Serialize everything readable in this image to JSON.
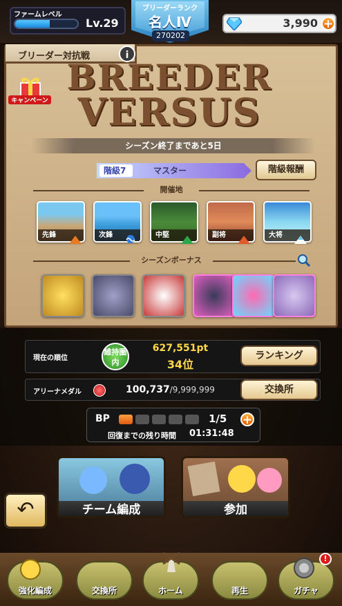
{
  "header": {
    "farm_level_label": "ファームレベル",
    "exp_progress": 0.55,
    "level": "Lv.29",
    "breeder_rank_label": "ブリーダーランク",
    "breeder_rank": "名人Ⅳ",
    "breeder_rank_id": "270202",
    "gems": "3,990",
    "gem_icon": "diamond-icon",
    "accent_color": "#e06000"
  },
  "panel": {
    "title": "ブリーダー対抗戦",
    "info_label": "i",
    "campaign_label": "キャンペーン",
    "logo_line1": "BREEDER",
    "logo_line2": "VERSUS",
    "season_text": "シーズン終了まであと5日",
    "tier_label": "階級7",
    "tier_name": "マスター",
    "tier_reward_button": "階級報酬",
    "venue_heading": "開催地",
    "venues": [
      {
        "label": "先鋒"
      },
      {
        "label": "次鋒"
      },
      {
        "label": "中堅"
      },
      {
        "label": "副将"
      },
      {
        "label": "大将"
      }
    ],
    "bonus_heading": "シーズンボーナス"
  },
  "ranking": {
    "current_label": "現在の順位",
    "status_badge": "維持圏内",
    "points": "627,551pt",
    "position": "34位",
    "ranking_button": "ランキング"
  },
  "medal": {
    "label": "アリーナメダル",
    "value": "100,737",
    "max": "/9,999,999",
    "exchange_button": "交換所"
  },
  "bp": {
    "label": "BP",
    "current": 1,
    "total": 5,
    "count_text": "1/5",
    "recover_label": "回復までの残り時間",
    "recover_time": "01:31:48"
  },
  "actions": {
    "team_button": "チーム編成",
    "join_button": "参加"
  },
  "nav": {
    "items": [
      {
        "label": "強化編成"
      },
      {
        "label": "交換所"
      },
      {
        "label": "ホーム"
      },
      {
        "label": "再生"
      },
      {
        "label": "ガチャ"
      }
    ],
    "notification": "!"
  }
}
